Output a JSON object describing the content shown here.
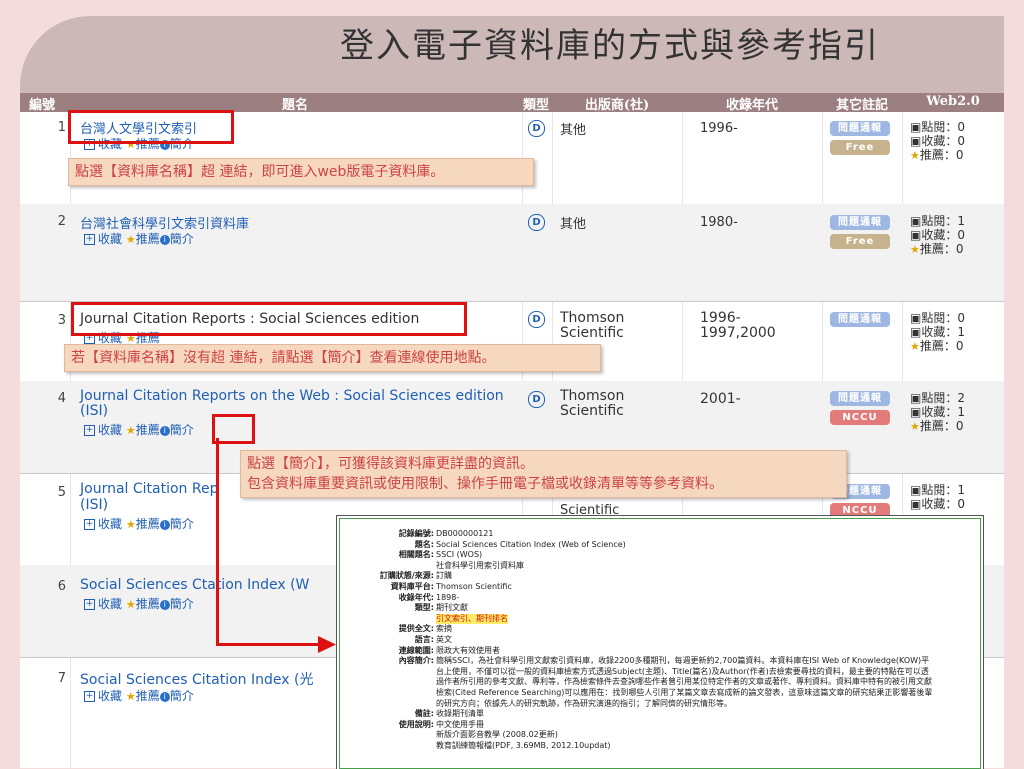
{
  "slide": {
    "title": "登入電子資料庫的方式與參考指引"
  },
  "table": {
    "headers": {
      "num": "編號",
      "title": "題名",
      "type": "類型",
      "publisher": "出版商(社)",
      "years": "收錄年代",
      "notes": "其它註記",
      "web": "Web2.0"
    },
    "links": {
      "collect": "收藏",
      "recommend": "推薦",
      "intro": "簡介"
    },
    "type_icon": "D",
    "web_labels": {
      "clicks": "點閱：",
      "collects": "收藏：",
      "recommends": "推薦："
    },
    "rows": [
      {
        "num": "1",
        "title": "台灣人文學引文索引",
        "publisher": "其他",
        "years": "1996-",
        "badges": [
          "問題通報",
          "Free"
        ],
        "clicks": "0",
        "collects": "0",
        "recommends": "0"
      },
      {
        "num": "2",
        "title": "台灣社會科學引文索引資料庫",
        "publisher": "其他",
        "years": "1980-",
        "badges": [
          "問題通報",
          "Free"
        ],
        "clicks": "1",
        "collects": "0",
        "recommends": "0"
      },
      {
        "num": "3",
        "title": "Journal Citation Reports : Social Sciences edition",
        "publisher": "Thomson Scientific",
        "years": "1996-\n1997,2000",
        "badges": [
          "問題通報"
        ],
        "clicks": "0",
        "collects": "1",
        "recommends": "0"
      },
      {
        "num": "4",
        "title": "Journal Citation Reports on the Web : Social Sciences edition (ISI)",
        "publisher": "Thomson Scientific",
        "years": "2001-",
        "badges": [
          "問題通報",
          "NCCU"
        ],
        "clicks": "2",
        "collects": "1",
        "recommends": "0"
      },
      {
        "num": "5",
        "title": "Journal Citation Rep",
        "title2": "(ISI)",
        "publisher": "",
        "years": "",
        "badges": [
          "問題通報",
          "NCCU"
        ],
        "clicks": "1",
        "collects": "0",
        "recommends": ""
      },
      {
        "num": "6",
        "title": "Social Sciences C",
        "title_b": "tation Index (W",
        "publisher": "",
        "years": "",
        "badges": [],
        "clicks": "",
        "collects": "",
        "recommends": ""
      },
      {
        "num": "7",
        "title": "Social Sciences Citation Index (",
        "title_tail": "光",
        "publisher": "",
        "years": "",
        "badges": [],
        "clicks": "",
        "collects": "",
        "recommends": ""
      }
    ],
    "row5_partial_publisher": "Scientific"
  },
  "callouts": {
    "c1": "點選【資料庫名稱】超 連結，即可進入web版電子資料庫。",
    "c2": "若【資料庫名稱】沒有超 連結，請點選【簡介】查看連線使用地點。",
    "c3_line1": "點選【簡介】，可獲得該資料庫更詳盡的資訊。",
    "c3_line2": "包含資料庫重要資訊或使用限制、操作手冊電子檔或收錄清單等等參考資料。"
  },
  "popup": {
    "fields": [
      {
        "label": "記錄編號:",
        "value": "DB000000121"
      },
      {
        "label": "題名:",
        "value": "Social Sciences Citation Index (Web of Science)"
      },
      {
        "label": "相關題名:",
        "value": "SSCI (WOS)"
      },
      {
        "label": "",
        "value": "社會科學引用索引資料庫"
      },
      {
        "label": "訂購狀態/來源:",
        "value": "訂購"
      },
      {
        "label": "資料庫平台:",
        "value": "Thomson Scientific"
      },
      {
        "label": "收錄年代:",
        "value": "1898-"
      },
      {
        "label": "類型:",
        "value": "期刊文獻"
      },
      {
        "label": "",
        "value": "引文索引、期刊排名"
      },
      {
        "label": "提供全文:",
        "value": "索摘"
      },
      {
        "label": "語言:",
        "value": "英文"
      },
      {
        "label": "連線範圍:",
        "value": "限政大有效使用者"
      },
      {
        "label": "內容簡介:",
        "value": "簡稱SSCI，為社會科學引用文獻索引資料庫，收錄2200多種期刊，每週更新約2,700篇資料。本資料庫在ISI Web of Knowledge(KOW)平"
      },
      {
        "label": "",
        "value": "台上使用，不僅可以從一般的資料庫檢索方式透過Subject(主題)、Title(篇名)及Author(作者)去檢索要尋找的資料，最主要的特點在可以透"
      },
      {
        "label": "",
        "value": "過作者所引用的參考文獻、專利等，作為檢索條件去查詢哪些作者曾引用某位特定作者的文章或著作、專利資料。資料庫中特有的被引用文獻"
      },
      {
        "label": "",
        "value": "檢索(Cited Reference Searching)可以應用在：找到哪些人引用了某篇文章去寫成新的論文發表，這意味這篇文章的研究結果正影響著後輩"
      },
      {
        "label": "",
        "value": "的研究方向；依據先人的研究軌跡，作為研究演進的指引；了解同儕的研究情形等。"
      },
      {
        "label": "備註:",
        "value": "收錄期刊清單"
      },
      {
        "label": "使用說明:",
        "value": "中文使用手冊"
      },
      {
        "label": "",
        "value": "新版介面影音教學 (2008.02更新)"
      },
      {
        "label": "",
        "value": "教育訓練簡報檔(PDF, 3.69MB, 2012.10updat)"
      }
    ]
  },
  "colors": {
    "header_bg": "#9c7f80",
    "link": "#1f5fb4",
    "callout_text": "#cc4444",
    "highlight": "#dd1111"
  }
}
